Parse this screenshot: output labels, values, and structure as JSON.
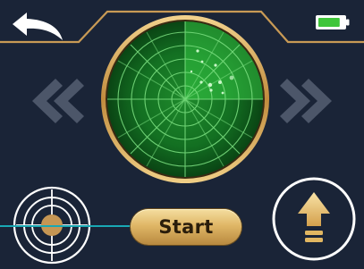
{
  "toolbar": {
    "back_icon": "back-arrow-icon",
    "battery_icon": "battery-icon",
    "battery_level": 0.85
  },
  "radar": {
    "icon": "radar-scope",
    "blip_count": 10
  },
  "navigation": {
    "previous_icon": "double-chevron-left-icon",
    "next_icon": "double-chevron-right-icon"
  },
  "controls": {
    "start_label": "Start",
    "target_icon": "crosshair-target-icon",
    "upgrade_icon": "upload-arrow-icon"
  },
  "colors": {
    "background": "#1a2437",
    "frame_gold": "#c89a55",
    "radar_green": "#2eb83c",
    "radar_dark": "#0d3a14",
    "chevron_inactive": "#4c5669",
    "button_gold": "#e0b767",
    "callout_line": "#19a8b4",
    "battery_green": "#3fc63a"
  }
}
